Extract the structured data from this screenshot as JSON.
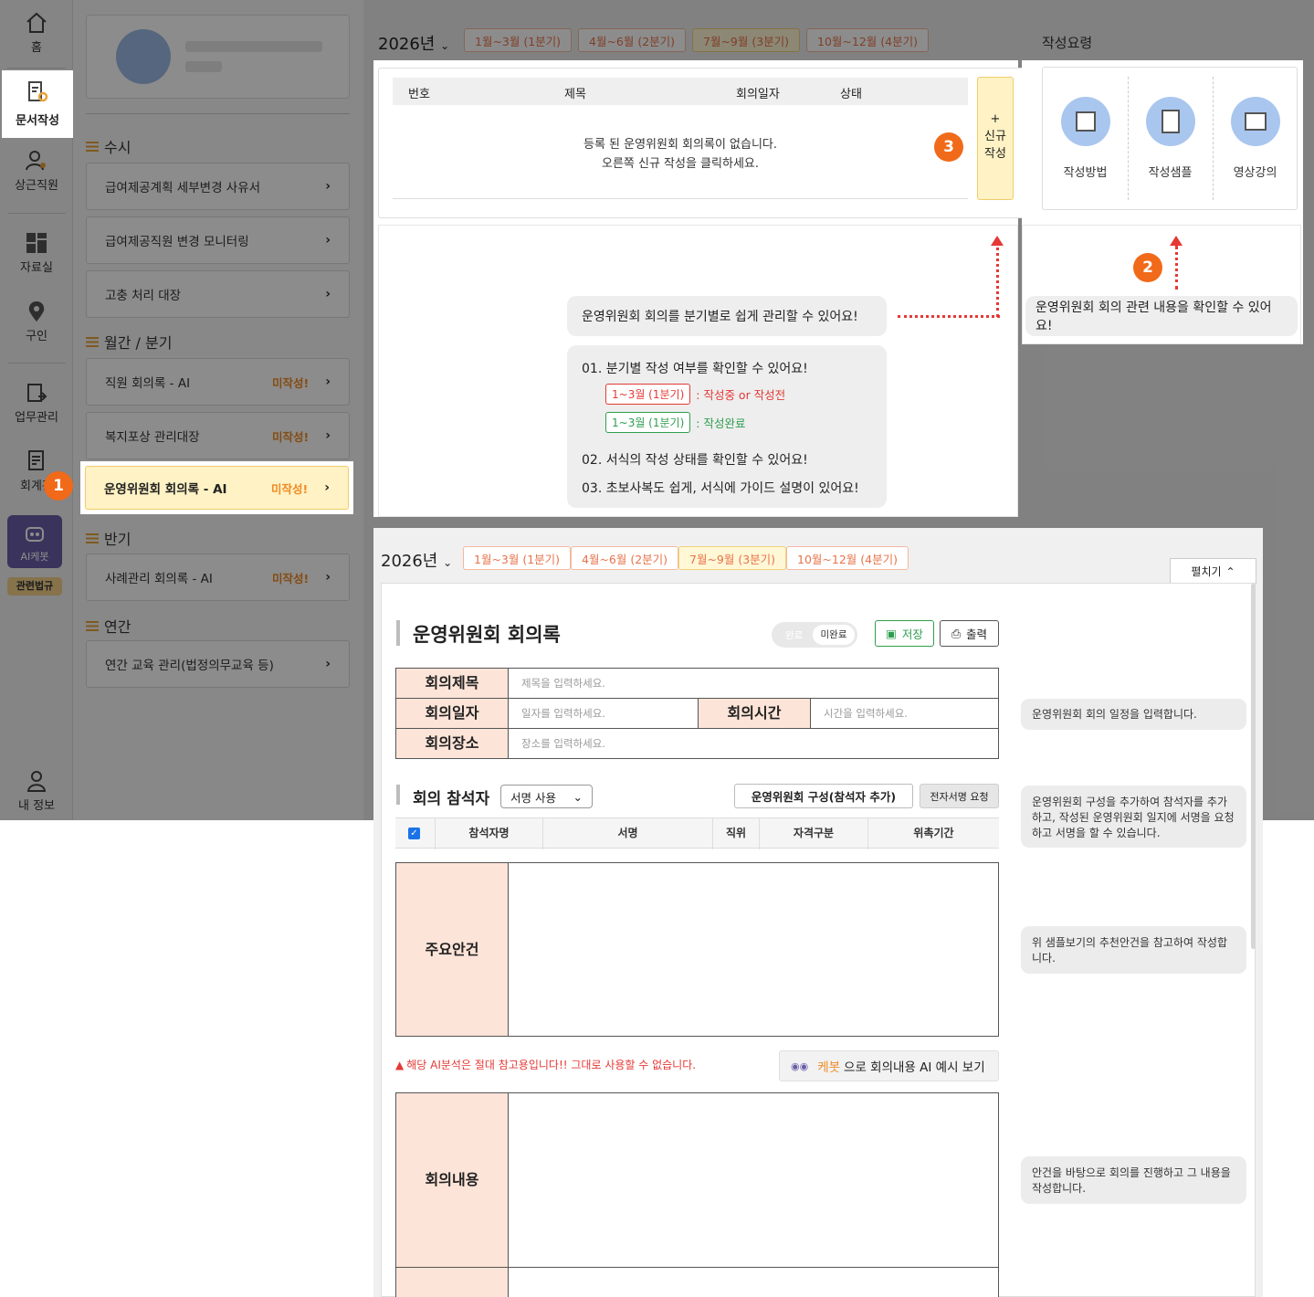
{
  "nav": {
    "home": "홈",
    "doc_write": "문서작성",
    "staff": "상근직원",
    "library": "자료실",
    "hiring": "구인",
    "work": "업무관리",
    "accounting": "회계관",
    "ai_bot": "AI케봇",
    "law": "관련법규",
    "my_info": "내 정보"
  },
  "menu": {
    "sections": {
      "adhoc": "수시",
      "monthly": "월간 / 분기",
      "half": "반기",
      "annual": "연간"
    },
    "items": [
      {
        "label": "급여제공계획 세부변경 사유서",
        "badge": ""
      },
      {
        "label": "급여제공직원 변경 모니터링",
        "badge": ""
      },
      {
        "label": "고충 처리 대장",
        "badge": ""
      },
      {
        "label": "직원 회의록 - AI",
        "badge": "미작성!"
      },
      {
        "label": "복지포상 관리대장",
        "badge": "미작성!"
      },
      {
        "label": "운영위원회 회의록 - AI",
        "badge": "미작성!"
      },
      {
        "label": "사례관리 회의록 - AI",
        "badge": "미작성!"
      },
      {
        "label": "연간 교육 관리(법정의무교육 등)",
        "badge": ""
      }
    ]
  },
  "top": {
    "year": "2026년",
    "quarters": [
      "1월~3월 (1분기)",
      "4월~6월 (2분기)",
      "7월~9월 (3분기)",
      "10월~12월 (4분기)"
    ],
    "guide_title": "작성요령"
  },
  "list": {
    "headers": [
      "번호",
      "제목",
      "회의일자",
      "상태"
    ],
    "empty_line1": "등록 된 운영위원회 회의록이 없습니다.",
    "empty_line2": "오른쪽 신규 작성을 클릭하세요.",
    "new_plus": "+",
    "new_line1": "신규",
    "new_line2": "작성"
  },
  "guide": {
    "items": [
      "작성방법",
      "작성샘플",
      "영상강의"
    ]
  },
  "markers": [
    "1",
    "2",
    "3"
  ],
  "callouts": {
    "quarterly": "운영위원회 회의를 분기별로 쉽게 관리할 수 있어요!",
    "related": "운영위원회 회의 관련 내용을 확인할 수 있어요!",
    "point1": "01. 분기별 작성 여부를 확인할 수 있어요!",
    "tag1": "1~3월 (1분기)",
    "tag1_desc": ": 작성중 or 작성전",
    "tag2": "1~3월 (1분기)",
    "tag2_desc": ": 작성완료",
    "point2": "02. 서식의 작성 상태를 확인할 수 있어요!",
    "point3": "03. 초보사복도 쉽게, 서식에 가이드 설명이 있어요!"
  },
  "form": {
    "year": "2026년",
    "collapse": "펼치기",
    "title": "운영위원회 회의록",
    "toggle_done": "완료",
    "toggle_undone": "미완료",
    "save": "저장",
    "print": "출력",
    "fields": {
      "title_label": "회의제목",
      "title_placeholder": "제목을 입력하세요.",
      "date_label": "회의일자",
      "date_placeholder": "일자를 입력하세요.",
      "time_label": "회의시간",
      "time_placeholder": "시간을 입력하세요.",
      "place_label": "회의장소",
      "place_placeholder": "장소를 입력하세요."
    },
    "attendees_title": "회의 참석자",
    "sign_select": "서명 사용",
    "add_member": "운영위원회 구성(참석자 추가)",
    "esign_request": "전자서명 요청",
    "att_headers": [
      "참석자명",
      "서명",
      "직위",
      "자격구분",
      "위촉기간"
    ],
    "agenda_label": "주요안건",
    "warning": "해당 AI분석은 절대 참고용입니다!! 그대로 사용할 수 없습니다.",
    "ai_bot_name": "케봇",
    "ai_btn_rest": "으로 회의내용 AI 예시 보기",
    "content_label": "회의내용",
    "notes": {
      "schedule": "운영위원회 회의 일정을 입력합니다.",
      "attendees": "운영위원회 구성을 추가하여 참석자를 추가하고, 작성된 운영위원회 일지에 서명을 요청하고 서명을 할 수 있습니다.",
      "agenda": "위 샘플보기의 추천안건을 참고하여 작성합니다.",
      "content": "안건을 바탕으로 회의를 진행하고 그 내용을 작성합니다."
    }
  },
  "colors": {
    "accent_orange": "#f06a1a",
    "label_bg": "#fde4d8",
    "warning_red": "#e53935",
    "highlight_yellow": "#fff2c4",
    "save_green": "#2e9e4f"
  }
}
